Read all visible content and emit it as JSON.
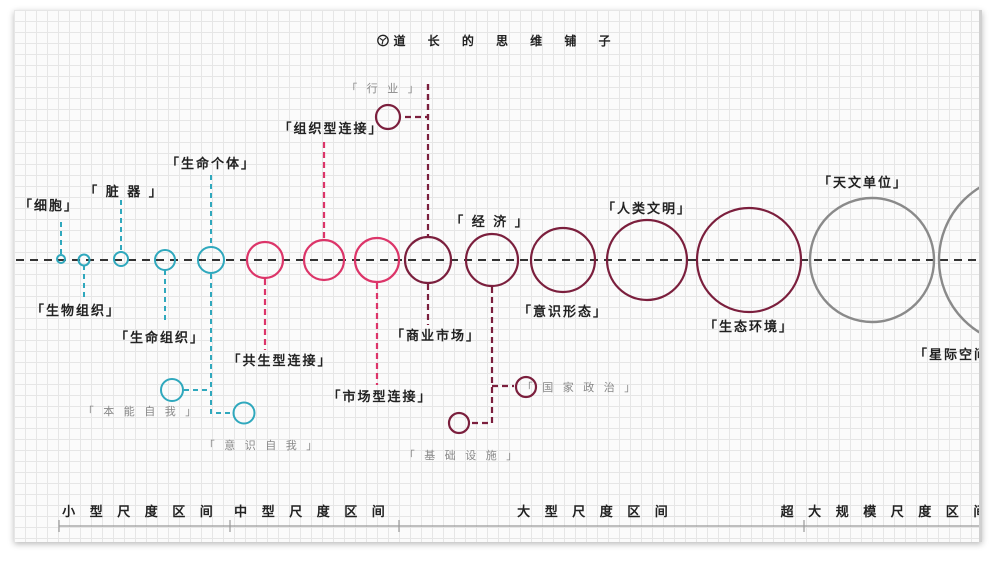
{
  "title": "道 长 的 思 维 铺 子",
  "colors": {
    "cyan": "#2fa8bd",
    "pink": "#dc3569",
    "maroon": "#7b1f3d",
    "gray": "#8a8a8a",
    "axis": "#333333"
  },
  "labels": [
    {
      "id": "cell",
      "text": "「细胞」"
    },
    {
      "id": "tissue",
      "text": "「生物组织」"
    },
    {
      "id": "organ",
      "text": "「 脏 器 」"
    },
    {
      "id": "life-org",
      "text": "「生命组织」"
    },
    {
      "id": "individual",
      "text": "「生命个体」"
    },
    {
      "id": "instinct",
      "text": "「 本 能 自 我 」"
    },
    {
      "id": "conscious",
      "text": "「 意 识 自 我 」"
    },
    {
      "id": "symbiosis",
      "text": "「共生型连接」"
    },
    {
      "id": "org-conn",
      "text": "「组织型连接」"
    },
    {
      "id": "market-conn",
      "text": "「市场型连接」"
    },
    {
      "id": "industry",
      "text": "「 行 业 」"
    },
    {
      "id": "biz-market",
      "text": "「商业市场」"
    },
    {
      "id": "economy",
      "text": "「 经 济 」"
    },
    {
      "id": "nation",
      "text": "「 国 家 政 治 」"
    },
    {
      "id": "infra",
      "text": "「 基 础 设 施 」"
    },
    {
      "id": "ideology",
      "text": "「意识形态」"
    },
    {
      "id": "civilization",
      "text": "「人类文明」"
    },
    {
      "id": "ecology",
      "text": "「生态环境」"
    },
    {
      "id": "astro",
      "text": "「天文单位」"
    },
    {
      "id": "space",
      "text": "「星际空间"
    }
  ],
  "ranges": [
    {
      "id": "small",
      "text": "小 型 尺 度 区 间"
    },
    {
      "id": "medium",
      "text": "中 型 尺 度 区 间"
    },
    {
      "id": "large",
      "text": "大 型 尺 度 区 间"
    },
    {
      "id": "xlarge",
      "text": "超 大 规 模 尺 度 区 间"
    }
  ]
}
